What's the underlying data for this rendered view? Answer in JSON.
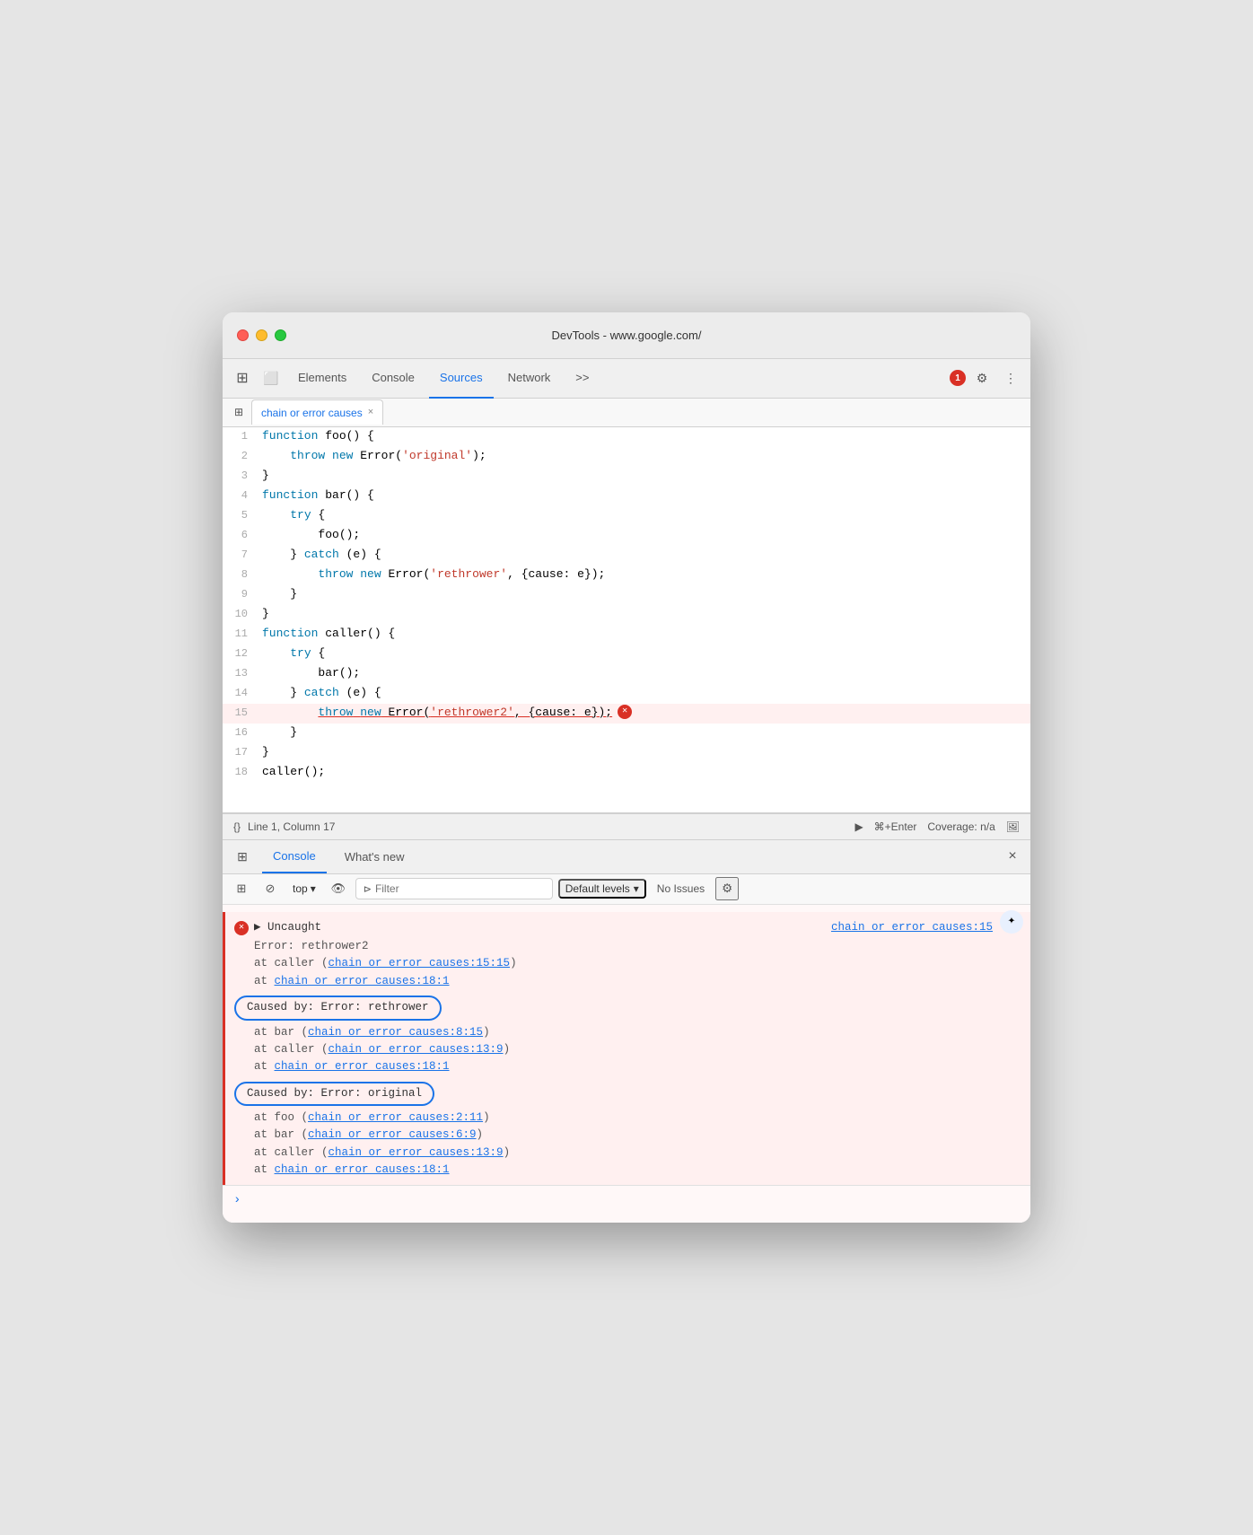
{
  "window": {
    "title": "DevTools - www.google.com/"
  },
  "devtools": {
    "tabs": [
      {
        "label": "Elements",
        "active": false
      },
      {
        "label": "Console",
        "active": false
      },
      {
        "label": "Sources",
        "active": true
      },
      {
        "label": "Network",
        "active": false
      }
    ],
    "more_tabs": ">>",
    "error_count": "1",
    "settings_icon": "⚙",
    "more_icon": "⋮"
  },
  "file_tab": {
    "label": "chain or error causes",
    "close": "×"
  },
  "code": {
    "lines": [
      {
        "num": 1,
        "text": "function foo() {",
        "type": "normal"
      },
      {
        "num": 2,
        "text": "    throw new Error('original');",
        "type": "normal"
      },
      {
        "num": 3,
        "text": "}",
        "type": "normal"
      },
      {
        "num": 4,
        "text": "function bar() {",
        "type": "normal"
      },
      {
        "num": 5,
        "text": "    try {",
        "type": "normal"
      },
      {
        "num": 6,
        "text": "        foo();",
        "type": "normal"
      },
      {
        "num": 7,
        "text": "    } catch (e) {",
        "type": "normal"
      },
      {
        "num": 8,
        "text": "        throw new Error('rethrower', {cause: e});",
        "type": "normal"
      },
      {
        "num": 9,
        "text": "    }",
        "type": "normal"
      },
      {
        "num": 10,
        "text": "}",
        "type": "normal"
      },
      {
        "num": 11,
        "text": "function caller() {",
        "type": "normal"
      },
      {
        "num": 12,
        "text": "    try {",
        "type": "normal"
      },
      {
        "num": 13,
        "text": "        bar();",
        "type": "normal"
      },
      {
        "num": 14,
        "text": "    } catch (e) {",
        "type": "normal"
      },
      {
        "num": 15,
        "text": "        throw new Error('rethrower2', {cause: e});",
        "type": "error"
      },
      {
        "num": 16,
        "text": "    }",
        "type": "normal"
      },
      {
        "num": 17,
        "text": "}",
        "type": "normal"
      },
      {
        "num": 18,
        "text": "caller();",
        "type": "normal"
      }
    ]
  },
  "status_bar": {
    "curly_icon": "{}",
    "position": "Line 1, Column 17",
    "play_icon": "▶",
    "shortcut": "⌘+Enter",
    "coverage": "Coverage: n/a",
    "screenshot_icon": "🖼"
  },
  "console": {
    "tabs": [
      {
        "label": "Console",
        "active": true
      },
      {
        "label": "What's new",
        "active": false
      }
    ],
    "close": "×",
    "toolbar": {
      "panel_icon": "⊞",
      "block_icon": "⊘",
      "top_label": "top",
      "eye_icon": "👁",
      "filter_icon": "⊳",
      "filter_placeholder": "Filter",
      "default_levels": "Default levels",
      "no_issues": "No Issues",
      "gear_icon": "⚙"
    },
    "error": {
      "uncaught_label": "▶ Uncaught",
      "file_link_main": "chain or error causes:15",
      "error_message": "Error: rethrower2",
      "stack": [
        "    at caller (chain or error causes:15:15)",
        "    at chain or error causes:18:1"
      ],
      "caused_by_1": {
        "label": "Caused by: Error: rethrower",
        "stack": [
          "    at bar (chain or error causes:8:15)",
          "    at caller (chain or error causes:13:9)",
          "    at chain or error causes:18:1"
        ]
      },
      "caused_by_2": {
        "label": "Caused by: Error: original",
        "stack": [
          "    at foo (chain or error causes:2:11)",
          "    at bar (chain or error causes:6:9)",
          "    at caller (chain or error causes:13:9)",
          "    at chain or error causes:18:1"
        ]
      }
    }
  }
}
